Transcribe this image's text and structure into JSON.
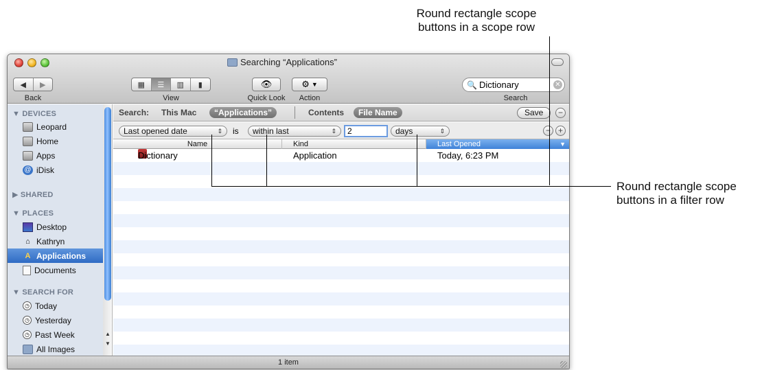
{
  "callouts": {
    "scope_row": [
      "Round rectangle scope",
      "buttons in a scope row"
    ],
    "filter_row": [
      "Round rectangle scope",
      "buttons in a filter row"
    ]
  },
  "window": {
    "title": "Searching “Applications”",
    "status_text": "1 item"
  },
  "toolbar": {
    "back_label": "Back",
    "view_label": "View",
    "quicklook_label": "Quick Look",
    "action_label": "Action",
    "search_label": "Search",
    "search_value": "Dictionary",
    "view_mode_selected": "list"
  },
  "sidebar": {
    "sections": [
      {
        "title": "▼ DEVICES",
        "items": [
          {
            "label": "Leopard",
            "icon": "hard-disk-icon"
          },
          {
            "label": "Home",
            "icon": "hard-disk-icon"
          },
          {
            "label": "Apps",
            "icon": "hard-disk-icon"
          },
          {
            "label": "iDisk",
            "icon": "idisk-icon"
          }
        ]
      },
      {
        "title": "▶ SHARED",
        "items": []
      },
      {
        "title": "▼ PLACES",
        "items": [
          {
            "label": "Desktop",
            "icon": "desktop-icon"
          },
          {
            "label": "Kathryn",
            "icon": "home-icon"
          },
          {
            "label": "Applications",
            "icon": "applications-icon",
            "selected": true
          },
          {
            "label": "Documents",
            "icon": "document-icon"
          }
        ]
      },
      {
        "title": "▼ SEARCH FOR",
        "items": [
          {
            "label": "Today",
            "icon": "clock-icon"
          },
          {
            "label": "Yesterday",
            "icon": "clock-icon"
          },
          {
            "label": "Past Week",
            "icon": "clock-icon"
          },
          {
            "label": "All Images",
            "icon": "folder-icon"
          }
        ]
      }
    ]
  },
  "scope": {
    "search_label": "Search:",
    "this_mac": "This Mac",
    "applications": "“Applications”",
    "contents": "Contents",
    "file_name": "File Name",
    "save": "Save"
  },
  "filter": {
    "attribute": "Last opened date",
    "is_label": "is",
    "operator": "within last",
    "value": "2",
    "unit": "days"
  },
  "list": {
    "columns": [
      "Name",
      "Kind",
      "Last Opened"
    ],
    "sorted_column": "Last Opened",
    "rows": [
      {
        "name": "Dictionary",
        "kind": "Application",
        "last_opened": "Today, 6:23 PM"
      }
    ]
  },
  "colors": {
    "selection_blue": "#2f6bc4",
    "sidebar_bg": "#dde4ee",
    "row_stripe": "#edf3fd"
  }
}
